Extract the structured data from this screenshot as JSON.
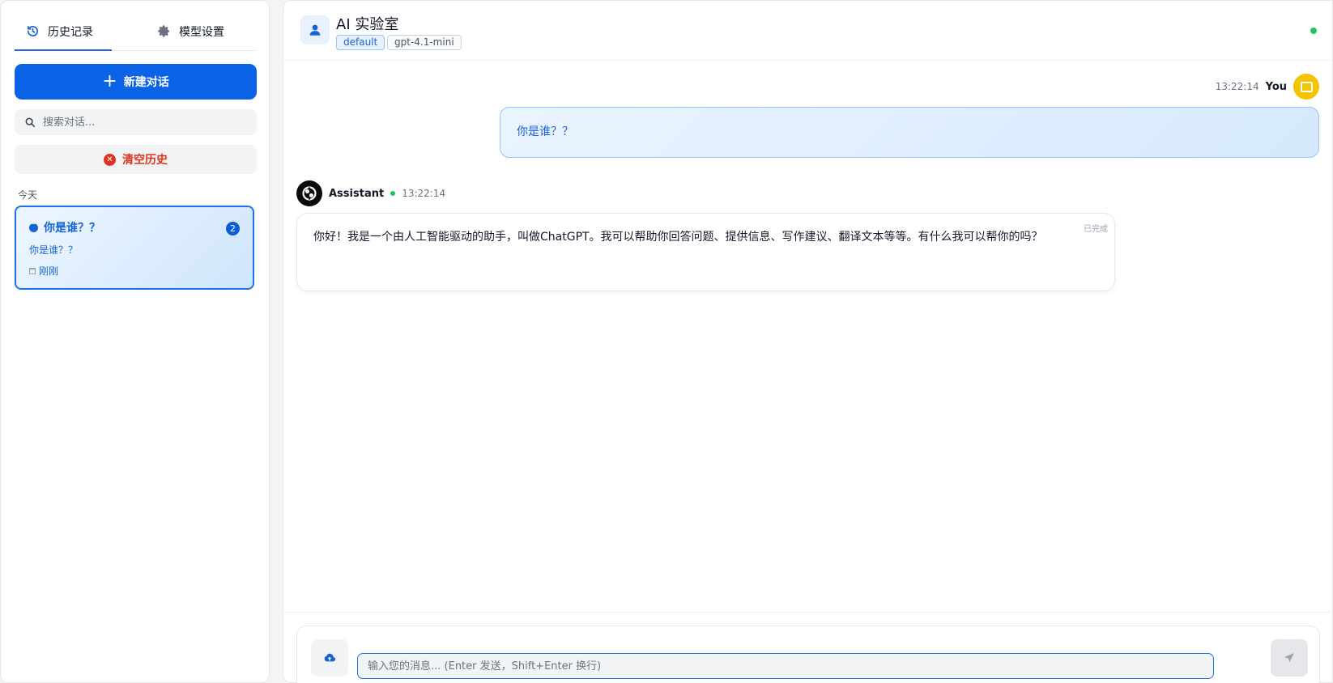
{
  "sidebar": {
    "tabs": [
      {
        "label": "历史记录",
        "icon": "history-icon",
        "active": true
      },
      {
        "label": "模型设置",
        "icon": "gear-icon",
        "active": false
      }
    ],
    "new_chat_label": "新建对话",
    "search_placeholder": "搜索对话...",
    "clear_history_label": "清空历史",
    "group_label": "今天",
    "conversations": [
      {
        "title": "你是谁？？",
        "preview": "你是谁？？",
        "time": "刚刚",
        "count": "2"
      }
    ]
  },
  "header": {
    "title": "AI 实验室",
    "tags": [
      "default",
      "gpt-4.1-mini"
    ],
    "status_color": "#22c55e"
  },
  "messages": {
    "user": {
      "name": "You",
      "time": "13:22:14",
      "text": "你是谁？？"
    },
    "assistant": {
      "name": "Assistant",
      "time": "13:22:14",
      "status": "已完成",
      "text": "你好！我是一个由人工智能驱动的助手，叫做ChatGPT。我可以帮助你回答问题、提供信息、写作建议、翻译文本等等。有什么我可以帮你的吗？"
    }
  },
  "composer": {
    "placeholder": "输入您的消息... (Enter 发送，Shift+Enter 换行)"
  },
  "colors": {
    "accent": "#0a63e6",
    "danger": "#e0321f",
    "user_avatar": "#f5c400"
  }
}
